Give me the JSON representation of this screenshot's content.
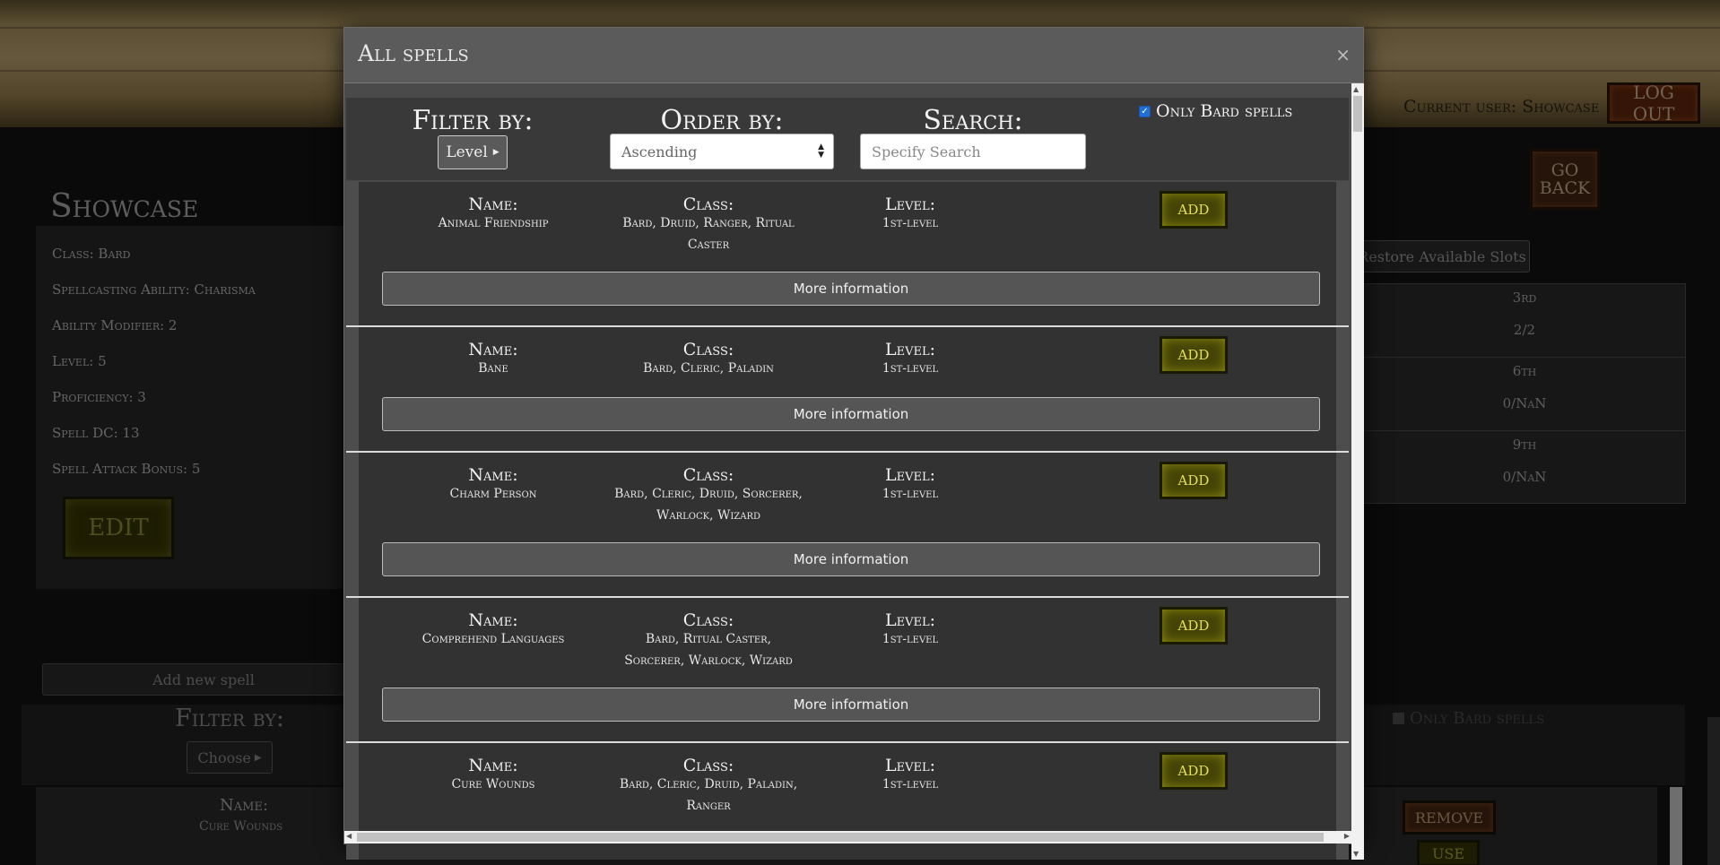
{
  "header": {
    "current_user_label": "Current user: Showcase",
    "logout_label": "LOG OUT",
    "go_back_label": "GO BACK"
  },
  "character": {
    "name": "Showcase",
    "lines": [
      "Class: Bard",
      "Spellcasting Ability: Charisma",
      "Ability Modifier: 2",
      "Level: 5",
      "Proficiency: 3",
      "Spell DC: 13",
      "Spell Attack Bonus: 5"
    ],
    "edit_label": "EDIT"
  },
  "slots": {
    "restore_label": "Restore Available Slots",
    "rows": [
      {
        "level": "3rd",
        "count": "2/2"
      },
      {
        "level": "6th",
        "count": "0/NaN"
      },
      {
        "level": "9th",
        "count": "0/NaN"
      }
    ]
  },
  "lower": {
    "add_new_spell_label": "Add new spell",
    "filter_label": "Filter by:",
    "choose_label": "Choose",
    "only_bard_label": "Only Bard spells",
    "name_label": "Name:",
    "name_value": "Cure Wounds",
    "remove_label": "REMOVE",
    "use_label": "USE"
  },
  "modal": {
    "title": "All spells",
    "close_glyph": "×",
    "filter_label": "Filter by:",
    "filter_value": "Level",
    "order_label": "Order by:",
    "order_value": "Ascending",
    "search_label": "Search:",
    "search_placeholder": "Specify Search",
    "only_bard_label": "Only Bard spells",
    "only_bard_checked": true,
    "col_name_label": "Name:",
    "col_class_label": "Class:",
    "col_level_label": "Level:",
    "add_label": "ADD",
    "more_info_label": "More information",
    "spells": [
      {
        "name": "Animal Friendship",
        "classes": "Bard, Druid, Ranger, Ritual Caster",
        "level": "1st-level"
      },
      {
        "name": "Bane",
        "classes": "Bard, Cleric, Paladin",
        "level": "1st-level"
      },
      {
        "name": "Charm Person",
        "classes": "Bard, Cleric, Druid, Sorcerer, Warlock, Wizard",
        "level": "1st-level"
      },
      {
        "name": "Comprehend Languages",
        "classes": "Bard, Ritual Caster, Sorcerer, Warlock, Wizard",
        "level": "1st-level"
      },
      {
        "name": "Cure Wounds",
        "classes": "Bard, Cleric, Druid, Paladin, Ranger",
        "level": "1st-level"
      }
    ]
  },
  "colors": {
    "add_button": "#454406",
    "checkbox_accent": "#1f6fd6",
    "wood": "#b39a62"
  },
  "icons": [
    "caret-right-icon",
    "select-arrows-icon",
    "close-icon",
    "checkbox-checked-icon"
  ]
}
